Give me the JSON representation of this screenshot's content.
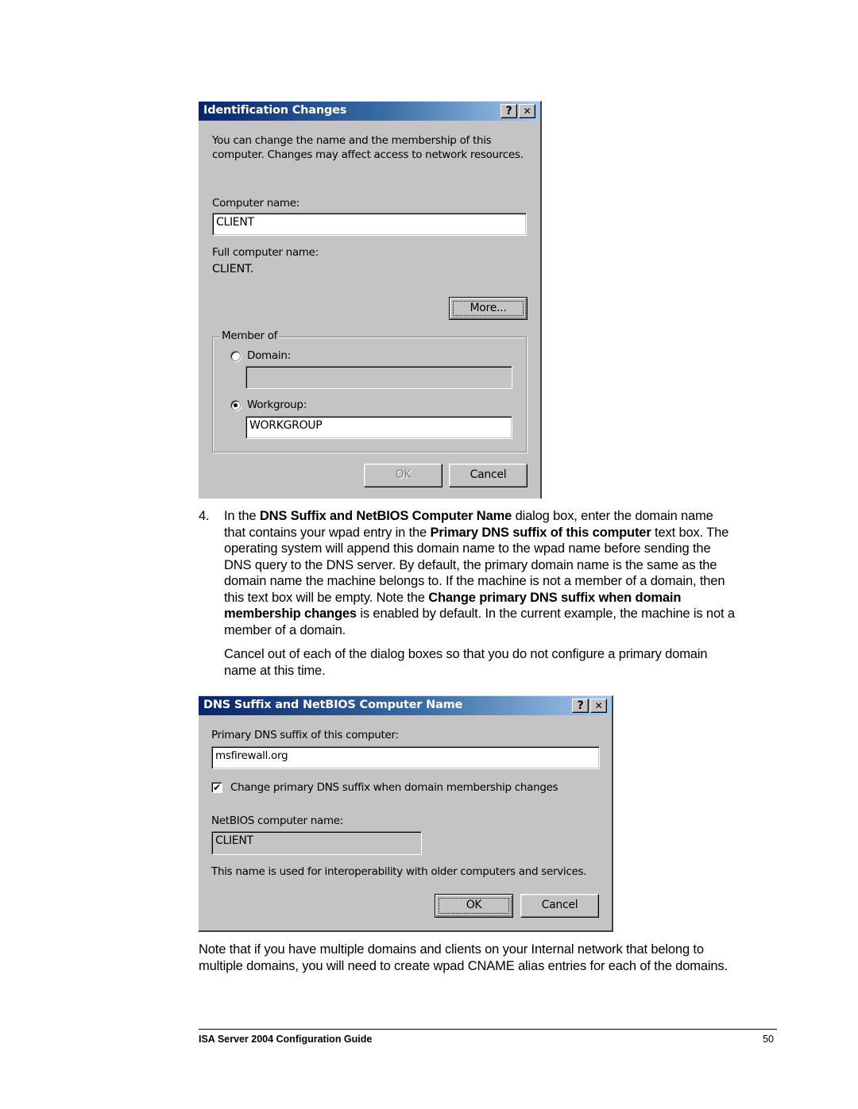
{
  "dialog1": {
    "title": "Identification Changes",
    "help_button": "?",
    "close_button": "✕",
    "intro_line1": "You can change the name and the membership of this",
    "intro_line2": "computer. Changes may affect access to network resources.",
    "computer_name_label": "Computer name:",
    "computer_name_value": "CLIENT",
    "full_name_label": "Full computer name:",
    "full_name_value": "CLIENT.",
    "more_button": "More...",
    "member_of_label": "Member of",
    "domain_label": "Domain:",
    "domain_value": "",
    "domain_selected": false,
    "workgroup_label": "Workgroup:",
    "workgroup_value": "WORKGROUP",
    "workgroup_selected": true,
    "ok_button": "OK",
    "cancel_button": "Cancel"
  },
  "step4": {
    "number": "4.",
    "lines": [
      [
        {
          "t": "In the "
        },
        {
          "t": "DNS Suffix and NetBIOS Computer Name",
          "b": true
        },
        {
          "t": " dialog box, enter the domain name"
        }
      ],
      [
        {
          "t": "that contains your wpad entry in the "
        },
        {
          "t": "Primary DNS suffix of this computer",
          "b": true
        },
        {
          "t": " text box. The"
        }
      ],
      [
        {
          "t": "operating system will append this domain name to the wpad name before sending the"
        }
      ],
      [
        {
          "t": "DNS query to the DNS server. By default, the primary domain name is the same as the"
        }
      ],
      [
        {
          "t": "domain name the machine belongs to. If the machine is not a member of a domain, then"
        }
      ],
      [
        {
          "t": "this text box will be empty. Note the "
        },
        {
          "t": "Change primary DNS suffix when domain",
          "b": true
        }
      ],
      [
        {
          "t": "membership changes",
          "b": true
        },
        {
          "t": " is enabled by default. In the current example, the machine is not a"
        }
      ],
      [
        {
          "t": "member of a domain."
        }
      ]
    ],
    "cancel_note_line1": "Cancel out of each of the dialog boxes so that you do not configure a primary domain",
    "cancel_note_line2": "name at this time."
  },
  "dialog2": {
    "title": "DNS Suffix and NetBIOS Computer Name",
    "help_button": "?",
    "close_button": "✕",
    "dns_suffix_label": "Primary DNS suffix of this computer:",
    "dns_suffix_value": "msfirewall.org",
    "change_suffix_label": "Change primary DNS suffix when domain membership changes",
    "change_suffix_checked": true,
    "check_mark": "✔",
    "netbios_label": "NetBIOS computer name:",
    "netbios_value": "CLIENT",
    "interop_note": "This name is used for interoperability with older computers and services.",
    "ok_button": "OK",
    "cancel_button": "Cancel"
  },
  "closing_note": {
    "line1": "Note that if you have multiple domains and clients on your Internal network that belong to",
    "line2": "multiple domains, you will need to create wpad CNAME alias entries for each of the domains."
  },
  "footer": {
    "title": "ISA Server 2004 Configuration Guide",
    "page_number": "50"
  }
}
